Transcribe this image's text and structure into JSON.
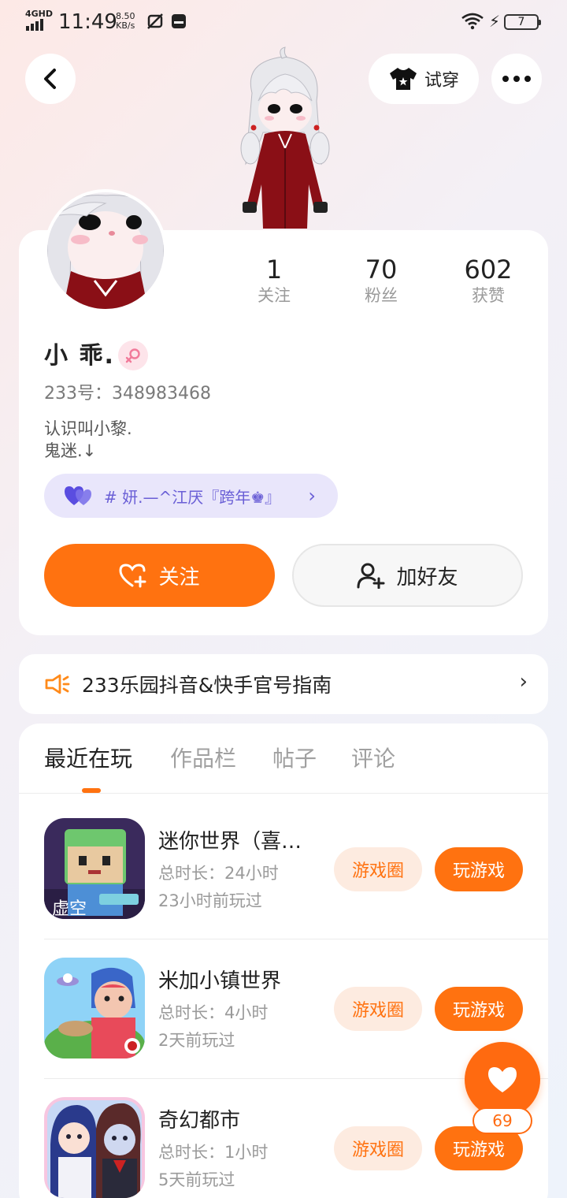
{
  "status_bar": {
    "network": "4GHD",
    "time": "11:49",
    "speed_value": "8.50",
    "speed_unit": "KB/s",
    "battery": "7"
  },
  "nav": {
    "try_on_label": "试穿",
    "back_icon": "chevron-left-icon",
    "more_icon": "more-dots-icon"
  },
  "profile": {
    "username": "小 乖.",
    "uid_label": "233号：",
    "uid_value": "348983468",
    "bio_line1": "认识叫小黎.",
    "bio_line2": "鬼迷.↓",
    "tag_text": "# 妍.—^江厌『跨年♚』",
    "stats": [
      {
        "value": "1",
        "label": "关注"
      },
      {
        "value": "70",
        "label": "粉丝"
      },
      {
        "value": "602",
        "label": "获赞"
      }
    ],
    "follow_label": "关注",
    "add_friend_label": "加好友"
  },
  "notice": {
    "text": "233乐园抖音&快手官号指南"
  },
  "tabs": [
    {
      "label": "最近在玩",
      "active": true
    },
    {
      "label": "作品栏",
      "active": false
    },
    {
      "label": "帖子",
      "active": false
    },
    {
      "label": "评论",
      "active": false
    }
  ],
  "games": [
    {
      "title": "迷你世界（喜…",
      "duration": "总时长：24小时",
      "last_played": "23小时前玩过",
      "circle_label": "游戏圈",
      "play_label": "玩游戏",
      "icon_text": "虚空"
    },
    {
      "title": "米加小镇世界",
      "duration": "总时长：4小时",
      "last_played": "2天前玩过",
      "circle_label": "游戏圈",
      "play_label": "玩游戏"
    },
    {
      "title": "奇幻都市",
      "duration": "总时长：1小时",
      "last_played": "5天前玩过",
      "circle_label": "游戏圈",
      "play_label": "玩游戏"
    }
  ],
  "fab": {
    "count": "69"
  },
  "colors": {
    "accent": "#ff7210",
    "tag_bg": "#e9e6fb",
    "tag_text": "#6a5fd6"
  }
}
